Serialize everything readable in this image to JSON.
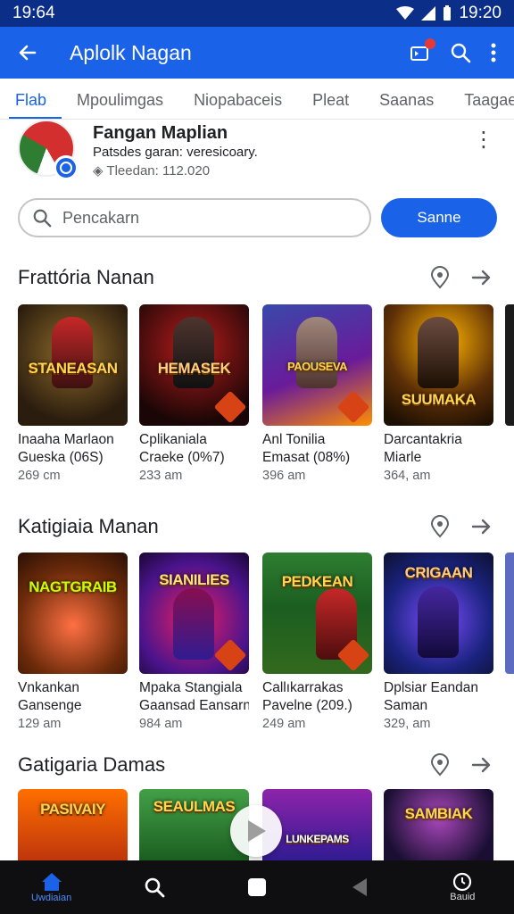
{
  "status": {
    "time_left": "19:64",
    "time_right": "19:20"
  },
  "app_bar": {
    "title": "Aplolk Nagan"
  },
  "tabs": [
    "Flab",
    "Mpoulimgas",
    "Niopabaceis",
    "Pleat",
    "Saanas",
    "Taagae"
  ],
  "app": {
    "name": "Fangan Maplian",
    "subtitle": "Patsdes garan: veresicoary.",
    "meta": "Tleedan: 112.020"
  },
  "search": {
    "placeholder": "Pencakarn",
    "button": "Sanne"
  },
  "sections": [
    {
      "title": "Frattória Nanan",
      "cards": [
        {
          "art_label": "STANEASAN",
          "name1": "Inaaha Marlaon",
          "name2": "Gueska (06S)",
          "size": "269 cm"
        },
        {
          "art_label": "HEMASEK",
          "name1": "Cplikaniala",
          "name2": "Craeke (0%7)",
          "size": "233 am"
        },
        {
          "art_label": "PAOUSEVA",
          "name1": "Anl Tonilia",
          "name2": "Emasat (08%)",
          "size": "396 am"
        },
        {
          "art_label": "SUUMAKA",
          "name1": "Darcantakria",
          "name2": "Miarle",
          "size": "364, am"
        }
      ]
    },
    {
      "title": "Katigiaia Manan",
      "cards": [
        {
          "art_label": "NAGTGRAIB",
          "name1": "Vnkankan",
          "name2": "Gansenge",
          "size": "129 am"
        },
        {
          "art_label": "SIANILIES",
          "name1": "Mpaka Stangiala",
          "name2": "Gaansad Eansarn",
          "size": "984 am"
        },
        {
          "art_label": "PEDKEAN",
          "name1": "Callıkarrakas",
          "name2": "Pavelne (209.)",
          "size": "249 am"
        },
        {
          "art_label": "CRIGAAN",
          "name1": "Dplsiar Eandan",
          "name2": "Saman",
          "size": "329, am"
        }
      ]
    },
    {
      "title": "Gatigaria Damas",
      "cards": [
        {
          "art_label": "PASIVAIY"
        },
        {
          "art_label": "SEAULMAS"
        },
        {
          "art_label": "LUNKEPAMS"
        },
        {
          "art_label": "SAMBIAK"
        }
      ]
    }
  ],
  "nav": {
    "home_label": "Uwdiaian",
    "right_label": "Bauid"
  },
  "colors": {
    "accent": "#1a63e8",
    "status_bar": "#0b2e88",
    "nav_bar": "#0f0f12"
  }
}
